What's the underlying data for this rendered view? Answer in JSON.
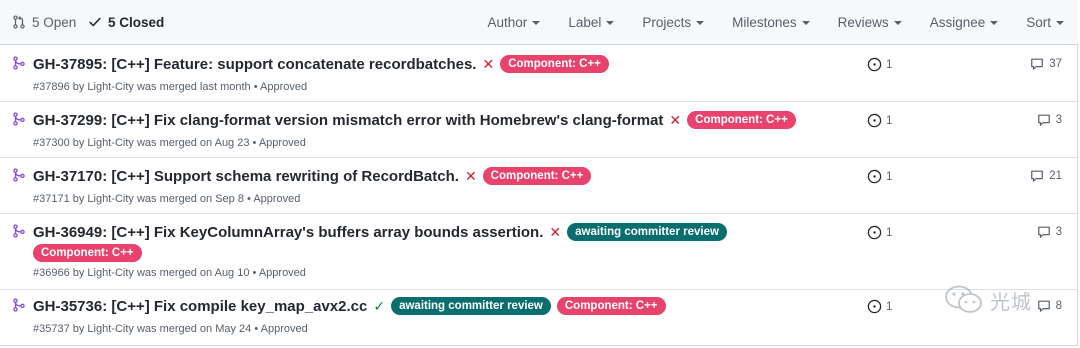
{
  "header": {
    "open_label": "5 Open",
    "closed_label": "5 Closed",
    "filters": [
      "Author",
      "Label",
      "Projects",
      "Milestones",
      "Reviews",
      "Assignee",
      "Sort"
    ]
  },
  "colors": {
    "merged_purple": "#8250df",
    "component_label": "#e8436c",
    "awaiting_label": "#0b6e6e",
    "close_x": "#cf222e",
    "check_green": "#1a7f37"
  },
  "rows": [
    {
      "title": "GH-37895: [C++] Feature: support concatenate recordbatches.",
      "status_icon": "x-icon",
      "labels": [
        "Component: C++"
      ],
      "meta": "#37896 by Light-City was merged last month • Approved",
      "linked_issues": "1",
      "comments": "37"
    },
    {
      "title": "GH-37299: [C++] Fix clang-format version mismatch error with Homebrew's clang-format",
      "status_icon": "x-icon",
      "labels": [
        "Component: C++"
      ],
      "meta": "#37300 by Light-City was merged on Aug 23 • Approved",
      "linked_issues": "1",
      "comments": "3"
    },
    {
      "title": "GH-37170: [C++] Support schema rewriting of RecordBatch.",
      "status_icon": "x-icon",
      "labels": [
        "Component: C++"
      ],
      "meta": "#37171 by Light-City was merged on Sep 8 • Approved",
      "linked_issues": "1",
      "comments": "21"
    },
    {
      "title": "GH-36949: [C++] Fix KeyColumnArray's buffers array bounds assertion.",
      "status_icon": "x-icon",
      "labels": [
        "awaiting committer review",
        "Component: C++"
      ],
      "meta": "#36966 by Light-City was merged on Aug 10 • Approved",
      "linked_issues": "1",
      "comments": "3"
    },
    {
      "title": "GH-35736: [C++] Fix compile key_map_avx2.cc",
      "status_icon": "check-icon",
      "labels": [
        "awaiting committer review",
        "Component: C++"
      ],
      "meta": "#35737 by Light-City was merged on May 24 • Approved",
      "linked_issues": "1",
      "comments": "8"
    }
  ],
  "watermark": {
    "text": "光城"
  }
}
